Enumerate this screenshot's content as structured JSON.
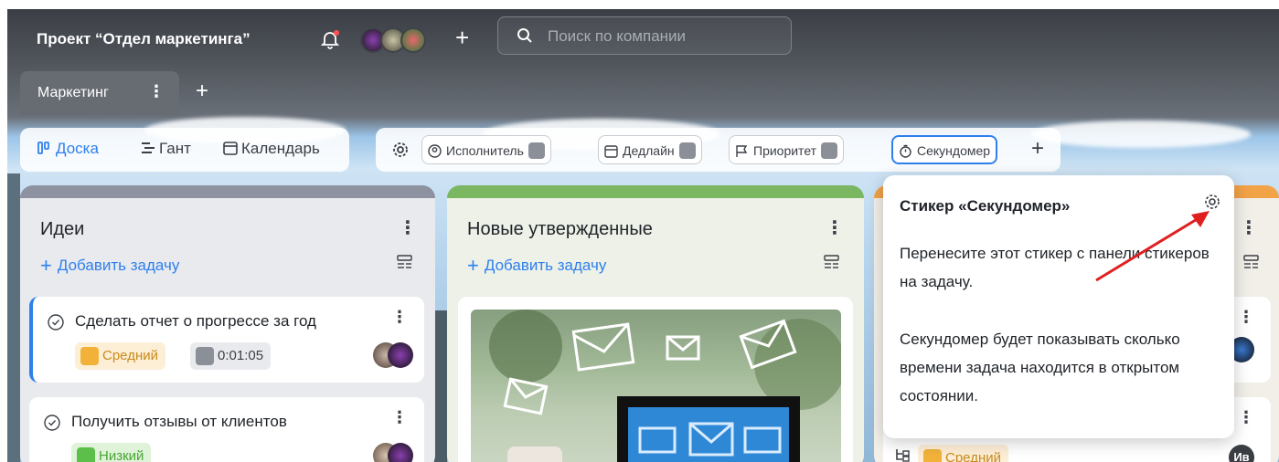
{
  "header": {
    "project_title": "Проект “Отдел маркетинга”",
    "search_placeholder": "Поиск по компании"
  },
  "tabs": [
    {
      "label": "Маркетинг"
    }
  ],
  "views": [
    {
      "label": "Доска",
      "active": true
    },
    {
      "label": "Гант",
      "active": false
    },
    {
      "label": "Календарь",
      "active": false
    }
  ],
  "filters": [
    {
      "label": "Исполнитель",
      "icon": "person-icon"
    },
    {
      "label": "Дедлайн",
      "icon": "calendar-icon"
    },
    {
      "label": "Приоритет",
      "icon": "flag-icon"
    },
    {
      "label": "Секундомер",
      "icon": "stopwatch-icon",
      "active": true
    }
  ],
  "columns": [
    {
      "title": "Идеи",
      "add_task": "Добавить задачу",
      "cards": [
        {
          "title": "Сделать отчет о прогрессе за год",
          "priority": "Средний",
          "timer": "0:01:05"
        },
        {
          "title": "Получить отзывы от клиентов",
          "priority": "Низкий"
        }
      ]
    },
    {
      "title": "Новые утвержденные",
      "add_task": "Добавить задачу"
    },
    {
      "partial_priority": "Средний",
      "avatar_initials": "Ив"
    }
  ],
  "popup": {
    "title": "Стикер «Секундомер»",
    "text1": "Перенесите этот стикер с панели стикеров на задачу.",
    "text2": "Секундомер будет показывать сколько времени задача находится в открытом состоянии."
  },
  "colors": {
    "accent": "#2f80ed",
    "medium": "#f2b23a",
    "low": "#5cbf4a",
    "arrow": "#e02020"
  }
}
